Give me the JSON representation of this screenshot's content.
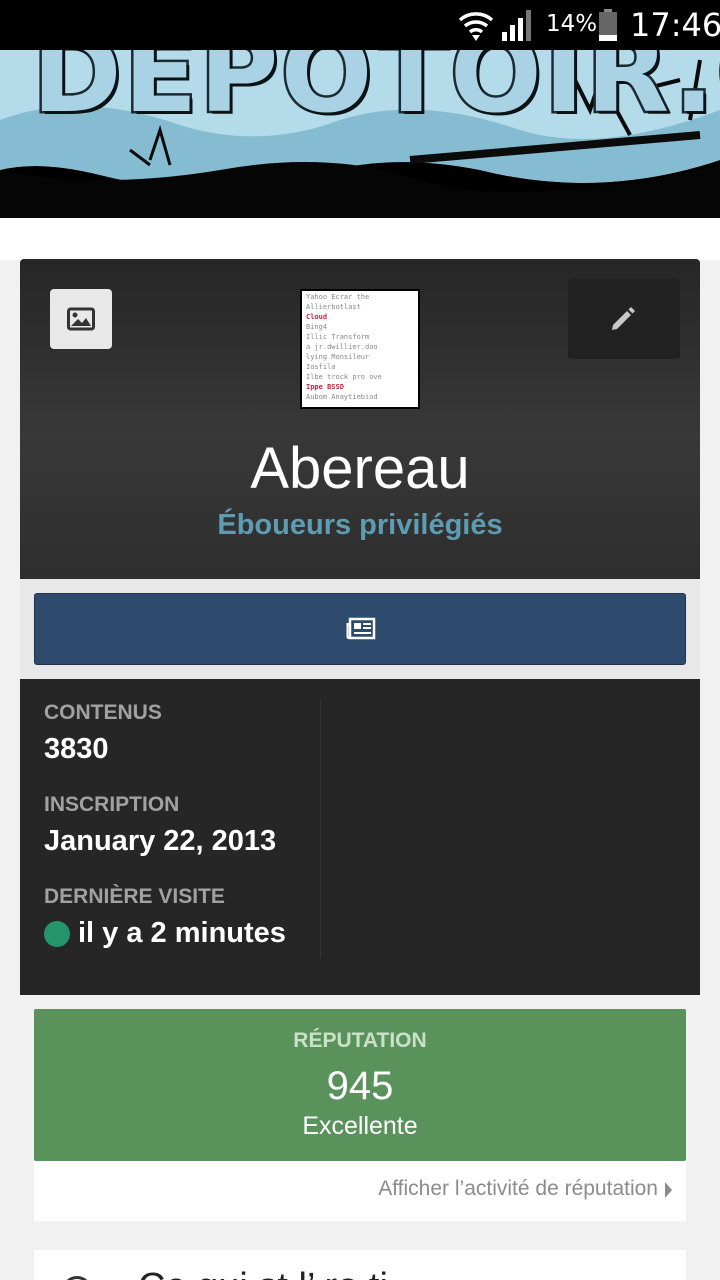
{
  "status_bar": {
    "battery_percent": "14%",
    "time": "17:46",
    "icons": [
      "wifi-icon",
      "signal-icon",
      "battery-icon"
    ]
  },
  "banner": {
    "logo_text": "DEPOTOIR.CA"
  },
  "profile": {
    "username": "Abereau",
    "group": "Éboueurs privilégiés",
    "group_color": "#5e9cb2",
    "avatar_text": {
      "lines": [
        "Yahoo   Ecrar the",
        "Allierbotlast",
        "          Cloud",
        "       Bing4",
        "Illic  Transform",
        "a   jr.dwillier.doo",
        "lying Monsileur",
        "          Iosfila",
        "Ilbe   trock pro ove",
        "Ippe         BSSD",
        "      Aubom Anaytiebiod"
      ]
    }
  },
  "buttons": {
    "change_cover_icon": "image-icon",
    "edit_icon": "pencil-icon",
    "activity_icon": "newspaper-icon"
  },
  "stats": {
    "content_label": "CONTENUS",
    "content_value": "3830",
    "joined_label": "INSCRIPTION",
    "joined_value": "January 22, 2013",
    "last_visit_label": "DERNIÈRE VISITE",
    "last_visit_value": "il y a 2 minutes",
    "online_color": "#24956b"
  },
  "reputation": {
    "label": "RÉPUTATION",
    "value": "945",
    "level": "Excellente",
    "color": "#5a925c",
    "activity_link": "Afficher l’activité de réputation"
  },
  "next_section": {
    "text_partial": "Ce qui st l’ ro ti"
  },
  "colors": {
    "activity_button": "#2e4a6c",
    "card_dark": "#262626"
  }
}
